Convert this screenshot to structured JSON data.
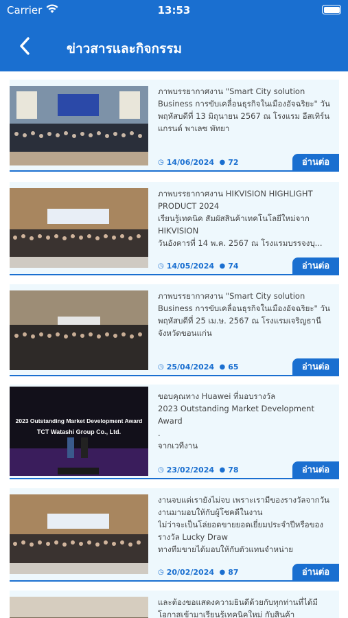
{
  "status": {
    "carrier": "Carrier",
    "time": "13:53"
  },
  "header": {
    "title": "ข่าวสารและกิจกรรม"
  },
  "news": [
    {
      "text": "ภาพบรรยากาศงาน \"Smart City solution Business การขับเคลื่อนธุรกิจในเมืองอัจฉริยะ\" วันพฤหัสบดีที่ 13 มิถุนายน 2567  ณ โรงแรม อีสเทิร์น แกรนด์ พาเลซ พัทยา",
      "date": "14/06/2024",
      "views": "72",
      "read_more": "อ่านต่อ"
    },
    {
      "text": "ภาพบรรยากาศงาน HIKVISION HIGHLIGHT PRODUCT 2024\nเรียนรู้เทคนิค สัมผัสสินค้าเทคโนโลยีใหม่จาก HIKVISION\nวันอังคารที่ 14 พ.ค. 2567 ณ โรงแรมบรรจงบุ...",
      "date": "14/05/2024",
      "views": "74",
      "read_more": "อ่านต่อ"
    },
    {
      "text": "ภาพบรรยากาศงาน \"Smart City solution Business การขับเคลื่อนธุรกิจในเมืองอัจฉริยะ\" วันพฤหัสบดีที่ 25 เม.ษ. 2567 ณ โรงแรมเจริญธานีจังหวัดขอนแก่น",
      "date": "25/04/2024",
      "views": "65",
      "read_more": "อ่านต่อ"
    },
    {
      "text": "ขอบคุณทาง Huawei ที่มอบรางวัล\n2023 Outstanding Market Development Award\n.\nจากเวทีงาน",
      "date": "23/02/2024",
      "views": "78",
      "read_more": "อ่านต่อ",
      "image_text": [
        "2023 Outstanding Market Development Award",
        "TCT Watashi Group Co., Ltd."
      ]
    },
    {
      "text": "งานจบแต่เรายังไม่จบ เพราะเรามีของรางวัลจากวันงานมามอบให้กับผู้โชคดีในงาน\nไม่ว่าจะเป็นโล่ยอดขายยอดเยี่ยมประจำปีหรือของรางวัล Lucky Draw\nทางทีมขายได้มอบให้กับตัวแทนจำหน่าย",
      "date": "20/02/2024",
      "views": "87",
      "read_more": "อ่านต่อ"
    },
    {
      "text": "และต้องขอแสดงความยินดีด้วยกับทุกท่านที่ได้มีโอกาสเข้ามาเรียนรู้เทคนิคใหม่ กับสินค้า",
      "date": "",
      "views": "",
      "read_more": ""
    }
  ],
  "colors": {
    "primary": "#1a6fd0",
    "card_bg": "#eef8fd"
  }
}
